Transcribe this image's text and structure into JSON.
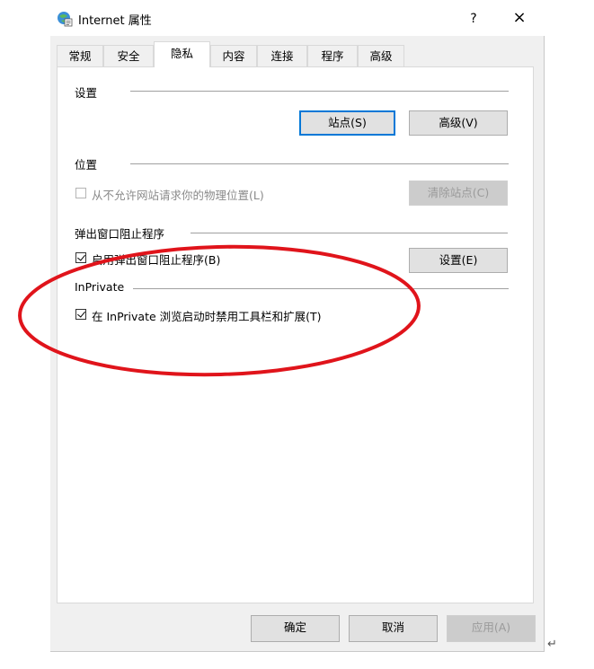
{
  "window": {
    "title": "Internet 属性",
    "help_glyph": "?",
    "close_glyph": "×",
    "icon": "internet-options-icon"
  },
  "tabs": [
    {
      "label": "常规"
    },
    {
      "label": "安全"
    },
    {
      "label": "隐私",
      "active": true
    },
    {
      "label": "内容"
    },
    {
      "label": "连接"
    },
    {
      "label": "程序"
    },
    {
      "label": "高级"
    }
  ],
  "settings": {
    "heading": "设置",
    "sites_button": "站点(S)",
    "advanced_button": "高级(V)"
  },
  "location": {
    "heading": "位置",
    "checkbox_label": "从不允许网站请求你的物理位置(L)",
    "checked": false,
    "disabled": true,
    "clear_button": "清除站点(C)"
  },
  "popup": {
    "heading": "弹出窗口阻止程序",
    "checkbox_label": "启用弹出窗口阻止程序(B)",
    "checked": true,
    "settings_button": "设置(E)"
  },
  "inprivate": {
    "heading": "InPrivate",
    "checkbox_label": "在 InPrivate 浏览启动时禁用工具栏和扩展(T)",
    "checked": true
  },
  "footer": {
    "ok": "确定",
    "cancel": "取消",
    "apply": "应用(A)"
  },
  "colors": {
    "annotation": "#e0141b",
    "default_button_border": "#0078d7"
  }
}
